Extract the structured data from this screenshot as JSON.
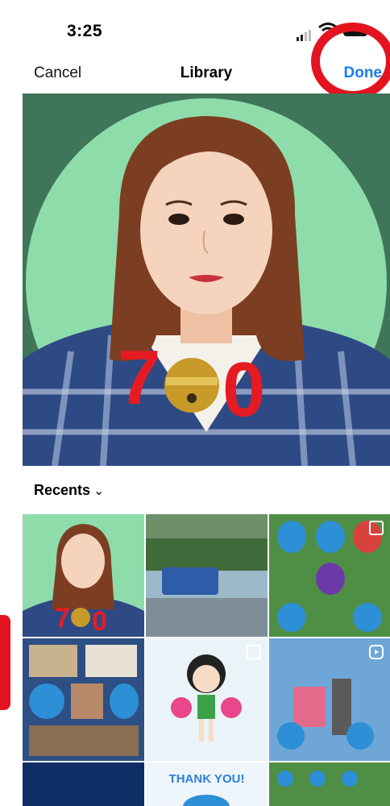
{
  "status_bar": {
    "time": "3:25",
    "icons": [
      "signal-icon",
      "wifi-icon",
      "battery-icon"
    ]
  },
  "navbar": {
    "cancel_label": "Cancel",
    "title": "Library",
    "done_label": "Done",
    "done_color": "#1d7bf0"
  },
  "annotation_color": "#e3141f",
  "album": {
    "label": "Recents",
    "chevron": "chevron-down-icon"
  },
  "preview": {
    "background_color": "#3f7558",
    "circle_color": "#8fdcab"
  },
  "grid_items": [
    {
      "name": "photo-portrait-thumbnail"
    },
    {
      "name": "photo-tram-thumbnail"
    },
    {
      "name": "photo-figurines-collage-thumbnail"
    },
    {
      "name": "photo-fan-collage-thumbnail"
    },
    {
      "name": "photo-cheerleader-drawing-thumbnail"
    },
    {
      "name": "reel-figurines-thumbnail",
      "icon": "reel-icon"
    },
    {
      "name": "photo-night-sky-thumbnail"
    },
    {
      "name": "photo-thank-you-thumbnail",
      "text": "THANK YOU!"
    },
    {
      "name": "photo-lawn-figurines-thumbnail"
    }
  ]
}
